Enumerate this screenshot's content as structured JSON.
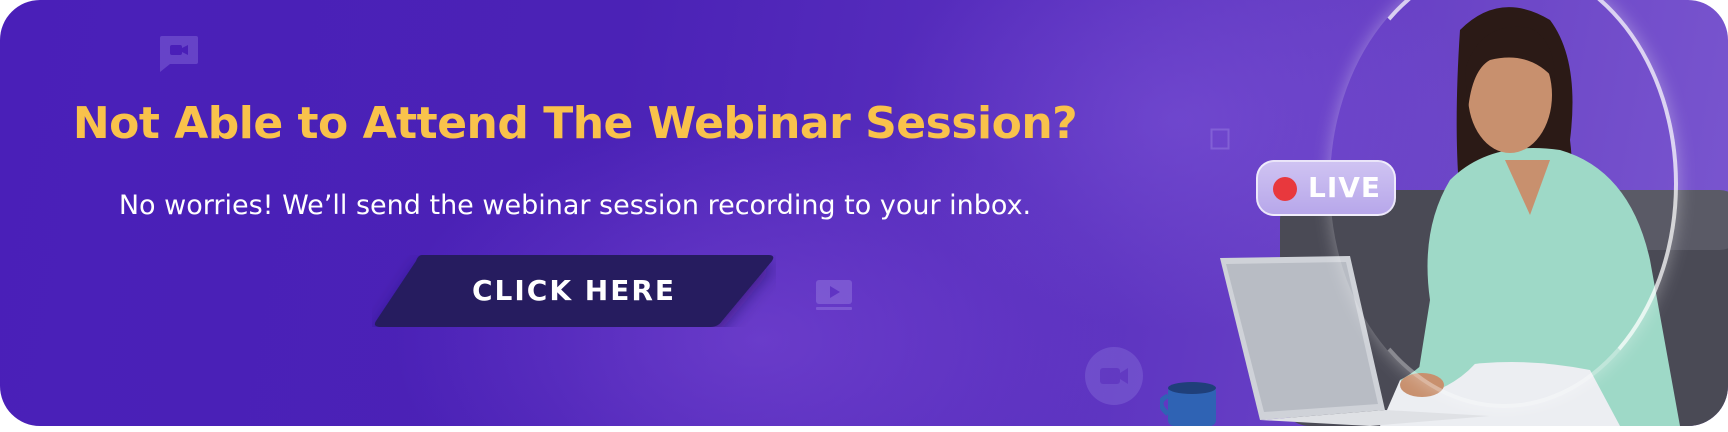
{
  "banner": {
    "headline": "Not Able to Attend The Webinar Session?",
    "subline": "No worries! We’ll send the webinar session recording to your inbox.",
    "cta_label": "CLICK HERE",
    "live_label": "LIVE",
    "colors": {
      "background": "#4a1fb8",
      "headline": "#f9c24b",
      "cta": "#241a5e",
      "live_dot": "#e8383d"
    },
    "icons": [
      "chat-video-icon",
      "play-video-icon",
      "video-camera-icon",
      "square-outline-icon"
    ]
  }
}
